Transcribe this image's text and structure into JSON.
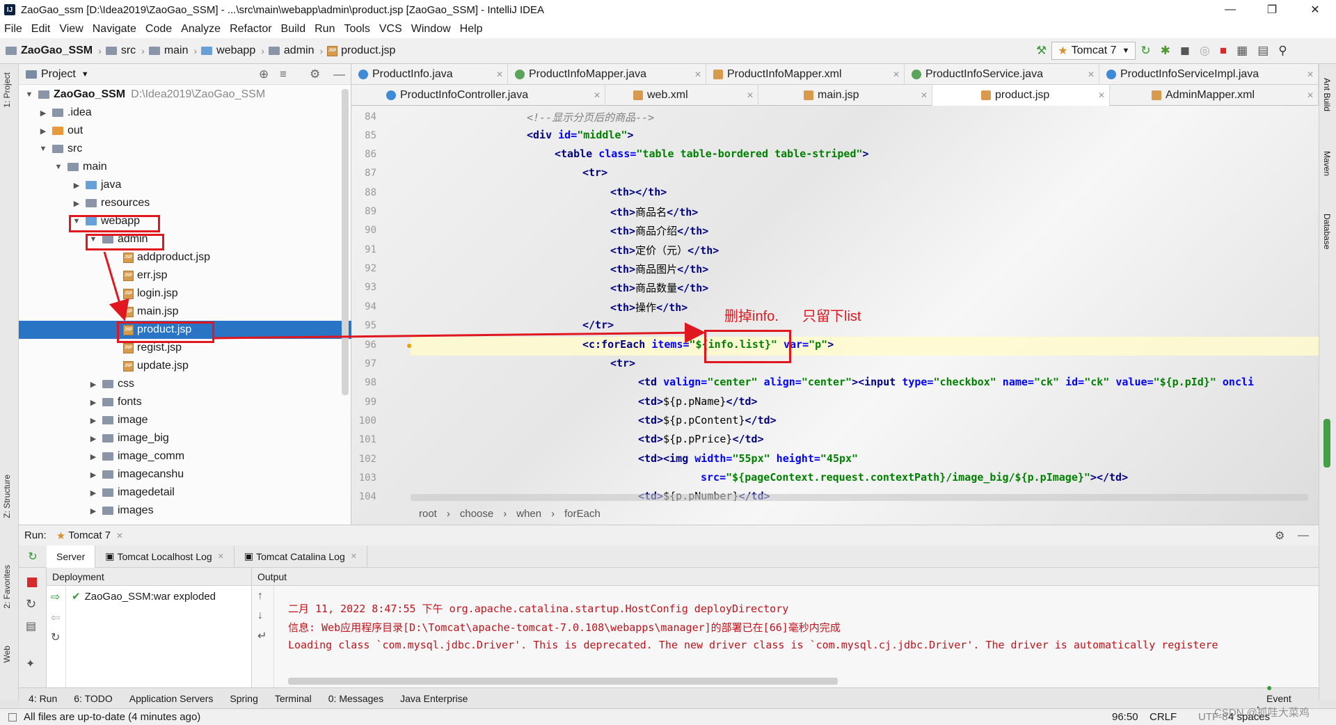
{
  "window": {
    "title": "ZaoGao_ssm [D:\\Idea2019\\ZaoGao_SSM] - ...\\src\\main\\webapp\\admin\\product.jsp [ZaoGao_SSM] - IntelliJ IDEA"
  },
  "menu": [
    "File",
    "Edit",
    "View",
    "Navigate",
    "Code",
    "Analyze",
    "Refactor",
    "Build",
    "Run",
    "Tools",
    "VCS",
    "Window",
    "Help"
  ],
  "breadcrumb": [
    "ZaoGao_SSM",
    "src",
    "main",
    "webapp",
    "admin",
    "product.jsp"
  ],
  "run_config": "Tomcat 7",
  "project_pane": {
    "title": "Project",
    "root_name": "ZaoGao_SSM",
    "root_path": "D:\\Idea2019\\ZaoGao_SSM",
    "items": [
      ".idea",
      "out",
      "src",
      "main",
      "java",
      "resources",
      "webapp",
      "admin",
      "addproduct.jsp",
      "err.jsp",
      "login.jsp",
      "main.jsp",
      "product.jsp",
      "regist.jsp",
      "update.jsp",
      "css",
      "fonts",
      "image",
      "image_big",
      "image_comm",
      "imagecanshu",
      "imagedetail",
      "images"
    ]
  },
  "editor_tabs_row1": [
    "ProductInfo.java",
    "ProductInfoMapper.java",
    "ProductInfoMapper.xml",
    "ProductInfoService.java",
    "ProductInfoServiceImpl.java"
  ],
  "editor_tabs_row2": [
    "ProductInfoController.java",
    "web.xml",
    "main.jsp",
    "product.jsp",
    "AdminMapper.xml"
  ],
  "code": {
    "line_numbers": [
      "84",
      "85",
      "86",
      "87",
      "88",
      "89",
      "90",
      "91",
      "92",
      "93",
      "94",
      "95",
      "96",
      "97",
      "98",
      "99",
      "100",
      "101",
      "102",
      "103",
      "104"
    ],
    "l84": "<!--显示分页后的商品-->",
    "l85a": "<div ",
    "l85b": "id=",
    "l85c": "\"middle\"",
    "l85d": ">",
    "l86a": "<table ",
    "l86b": "class=",
    "l86c": "\"table table-bordered table-striped\"",
    "l86d": ">",
    "l87": "<tr>",
    "l88": "<th></th>",
    "l89a": "<th>",
    "l89b": "商品名",
    "l89c": "</th>",
    "l90a": "<th>",
    "l90b": "商品介绍",
    "l90c": "</th>",
    "l91a": "<th>",
    "l91b": "定价（元）",
    "l91c": "</th>",
    "l92a": "<th>",
    "l92b": "商品图片",
    "l92c": "</th>",
    "l93a": "<th>",
    "l93b": "商品数量",
    "l93c": "</th>",
    "l94a": "<th>",
    "l94b": "操作",
    "l94c": "</th>",
    "l95": "</tr>",
    "l96a": "<c:forEach ",
    "l96b": "items=",
    "l96c": "\"${info.list}\"",
    "l96d": " var=",
    "l96e": "\"p\"",
    "l96f": ">",
    "l97": "<tr>",
    "l98a": "<td ",
    "l98b": "valign=",
    "l98c": "\"center\"",
    "l98d": " align=",
    "l98e": "\"center\"",
    "l98f": "><input ",
    "l98g": "type=",
    "l98h": "\"checkbox\"",
    "l98i": " name=",
    "l98j": "\"ck\"",
    "l98k": " id=",
    "l98l": "\"ck\"",
    "l98m": " value=",
    "l98n": "\"${p.pId}\"",
    "l98o": " oncli",
    "l99a": "<td>",
    "l99b": "${p.pName}",
    "l99c": "</td>",
    "l100a": "<td>",
    "l100b": "${p.pContent}",
    "l100c": "</td>",
    "l101a": "<td>",
    "l101b": "${p.pPrice}",
    "l101c": "</td>",
    "l102a": "<td><img ",
    "l102b": "width=",
    "l102c": "\"55px\"",
    "l102d": " height=",
    "l102e": "\"45px\"",
    "l103a": "src=",
    "l103b": "\"${pageContext.request.contextPath}/image_big/${p.pImage}\"",
    "l103c": "></td>",
    "l104a": "<td>",
    "l104b": "${p.pNumber}",
    "l104c": "</td>"
  },
  "editor_breadcrumb": [
    "root",
    "choose",
    "when",
    "forEach"
  ],
  "annotations": {
    "delete_info": "删掉info.",
    "keep_list": "只留下list"
  },
  "run_panel": {
    "label": "Run:",
    "config": "Tomcat 7",
    "tabs": [
      "Server",
      "Tomcat Localhost Log",
      "Tomcat Catalina Log"
    ],
    "deployment_header": "Deployment",
    "output_header": "Output",
    "deployment_item": "ZaoGao_SSM:war exploded",
    "output_lines": [
      "二月 11, 2022 8:47:55 下午 org.apache.catalina.startup.HostConfig deployDirectory",
      "信息: Web应用程序目录[D:\\Tomcat\\apache-tomcat-7.0.108\\webapps\\manager]的部署已在[66]毫秒内完成",
      "Loading class `com.mysql.jdbc.Driver'. This is deprecated. The new driver class is `com.mysql.cj.jdbc.Driver'. The driver is automatically registere"
    ]
  },
  "tool_windows": [
    "4: Run",
    "6: TODO",
    "Application Servers",
    "Spring",
    "Terminal",
    "0: Messages",
    "Java Enterprise"
  ],
  "event_log": "Event Log",
  "status": {
    "message": "All files are up-to-date (4 minutes ago)",
    "position": "96:50",
    "line_sep": "CRLF",
    "encoding": "UTF-8",
    "indent": "4 spaces",
    "watermark": "CSDN @抓哇大菜鸡"
  },
  "left_stripe": [
    "1: Project",
    "Z: Structure",
    "2: Favorites",
    "Web"
  ],
  "right_stripe": [
    "Ant Build",
    "Maven",
    "Database"
  ]
}
